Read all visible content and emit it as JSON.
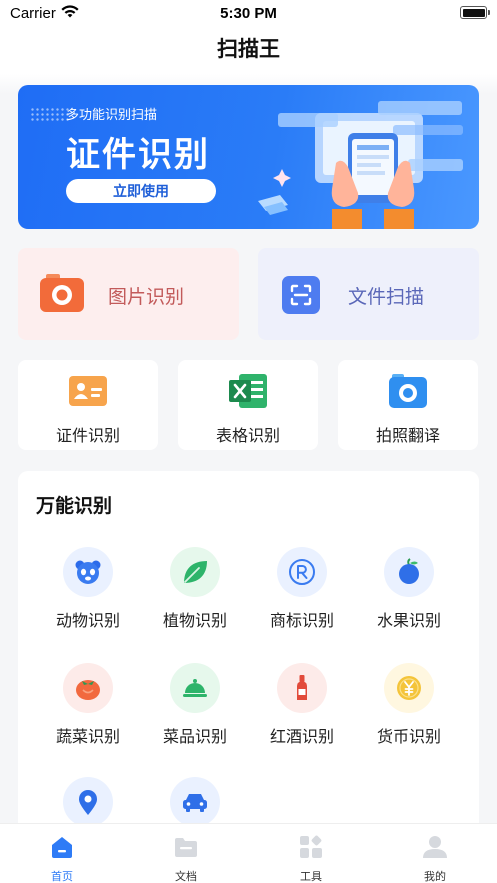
{
  "status": {
    "carrier": "Carrier",
    "time": "5:30 PM"
  },
  "navbar": {
    "title": "扫描王"
  },
  "banner": {
    "subtitle": "多功能识别扫描",
    "title": "证件识别",
    "cta": "立即使用"
  },
  "big_cards": [
    {
      "label": "图片识别",
      "icon": "camera-icon",
      "color": "#f26b3a"
    },
    {
      "label": "文件扫描",
      "icon": "scan-icon",
      "color": "#4e7cf0"
    }
  ],
  "small_cards": [
    {
      "label": "证件识别",
      "icon": "id-card-icon"
    },
    {
      "label": "表格识别",
      "icon": "excel-icon"
    },
    {
      "label": "拍照翻译",
      "icon": "translate-camera-icon"
    }
  ],
  "universal": {
    "heading": "万能识别",
    "items": [
      {
        "label": "动物识别",
        "icon": "panda-icon"
      },
      {
        "label": "植物识别",
        "icon": "leaf-icon"
      },
      {
        "label": "商标识别",
        "icon": "registered-icon"
      },
      {
        "label": "水果识别",
        "icon": "apple-icon"
      },
      {
        "label": "蔬菜识别",
        "icon": "tomato-icon"
      },
      {
        "label": "菜品识别",
        "icon": "dish-cloche-icon"
      },
      {
        "label": "红酒识别",
        "icon": "wine-bottle-icon"
      },
      {
        "label": "货币识别",
        "icon": "coin-icon"
      },
      {
        "label": "",
        "icon": "location-pin-icon"
      },
      {
        "label": "",
        "icon": "car-icon"
      }
    ]
  },
  "tabbar": {
    "active_color": "#2e7bf6",
    "tabs": [
      {
        "label": "首页",
        "icon": "home-icon"
      },
      {
        "label": "文档",
        "icon": "folder-icon"
      },
      {
        "label": "工具",
        "icon": "tools-icon"
      },
      {
        "label": "我的",
        "icon": "profile-icon"
      }
    ]
  }
}
